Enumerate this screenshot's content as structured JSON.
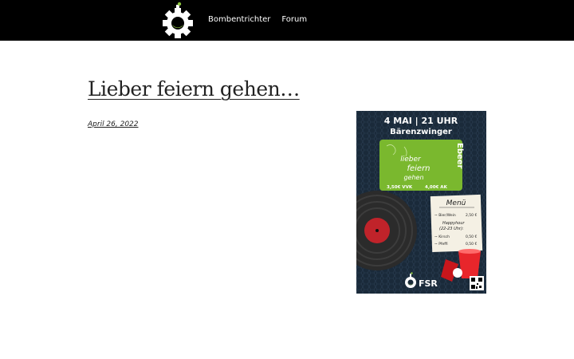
{
  "nav": {
    "items": [
      {
        "label": "Bombentrichter"
      },
      {
        "label": "Forum"
      }
    ]
  },
  "post": {
    "title": "Lieber feiern gehen…",
    "date": "April 26, 2022"
  },
  "poster": {
    "headline": "4 MAI | 21 UHR",
    "venue": "Bärenzwinger",
    "card_text_line1": "lieber",
    "card_text_line2": "feiern",
    "card_text_line3": "gehen",
    "card_side": "Ebeer",
    "price_vvk": "3,50€ VVK",
    "price_ak": "4,00€ AK",
    "menu_title": "Menü",
    "menu_items": [
      {
        "name": "~ Bier/Wein",
        "price": "2,50 €"
      },
      {
        "name": "Happyhour",
        "price": ""
      },
      {
        "name": "(22-23 Uhr):",
        "price": ""
      },
      {
        "name": "~ Kirsch",
        "price": "0,50 €"
      },
      {
        "name": "~ Pfeffi",
        "price": "0,50 €"
      }
    ],
    "brand": "FSR"
  },
  "colors": {
    "header_bg": "#000000",
    "logo_green": "#8dc63f",
    "poster_bg": "#1a2a3a",
    "card_green": "#7ab82e",
    "cup_red": "#e8262b"
  }
}
